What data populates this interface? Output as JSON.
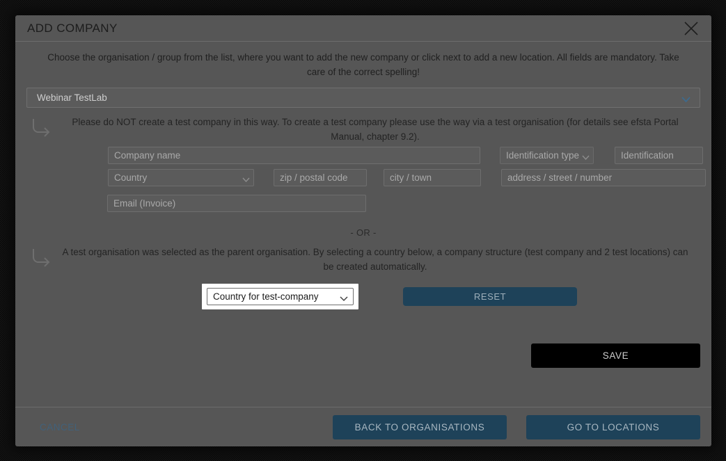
{
  "modal": {
    "title": "ADD COMPANY",
    "close_icon": "close-icon",
    "intro": "Choose the organisation / group from the list, where you want to add the new company or click next to add a new location. All fields are mandatory. Take care of the correct spelling!",
    "org_select": {
      "value": "Webinar TestLab",
      "icon": "chevron-down-icon"
    },
    "hint_company": "Please do NOT create a test company in this way. To create a test company please use the way via a test organisation (for details see efsta Portal Manual, chapter 9.2).",
    "hint_test": "A test organisation was selected as the parent organisation. By selecting a country below, a company structure (test company and 2 test locations) can be created automatically.",
    "or_separator": "- OR -",
    "turn_arrow_icon": "arrow-turn-down-right-icon"
  },
  "form": {
    "company_name": {
      "placeholder": "Company name",
      "value": ""
    },
    "identification_type": {
      "value": "Identification type",
      "icon": "chevron-down-icon"
    },
    "identification": {
      "placeholder": "Identification",
      "value": ""
    },
    "country": {
      "value": "Country",
      "icon": "chevron-down-icon"
    },
    "zip": {
      "placeholder": "zip / postal code",
      "value": ""
    },
    "city": {
      "placeholder": "city / town",
      "value": ""
    },
    "address": {
      "placeholder": "address / street / number",
      "value": ""
    },
    "email": {
      "placeholder": "Email (Invoice)",
      "value": ""
    }
  },
  "test_section": {
    "country_select": {
      "value": "Country for test-company",
      "icon": "chevron-down-icon"
    },
    "reset_label": "RESET"
  },
  "actions": {
    "save_label": "SAVE",
    "cancel_label": "CANCEL",
    "back_label": "BACK TO ORGANISATIONS",
    "next_label": "GO TO LOCATIONS"
  },
  "colors": {
    "modal_bg": "#565656",
    "accent_blue": "#1e4259",
    "link_blue": "#41617a",
    "save_bg": "#000000",
    "chevron_blue": "#3d6b8e"
  }
}
